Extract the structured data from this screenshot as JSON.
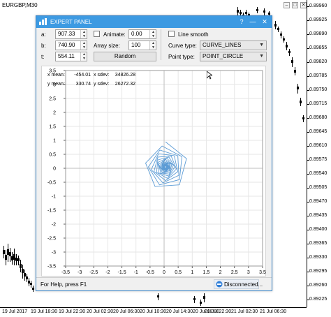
{
  "chart": {
    "symbol": "EURGBP,M30",
    "window_controls": {
      "minimize": "–",
      "restore": "□",
      "close": "✕"
    },
    "price_labels": [
      "0.89960",
      "0.89925",
      "0.89890",
      "0.89855",
      "0.89820",
      "0.89785",
      "0.89750",
      "0.89715",
      "0.89680",
      "0.89645",
      "0.89610",
      "0.89575",
      "0.89540",
      "0.89505",
      "0.89470",
      "0.89435",
      "0.89400",
      "0.89365",
      "0.89330",
      "0.89295",
      "0.89260",
      "0.89225"
    ],
    "time_labels": [
      "19 Jul 2017",
      "19 Jul 18:30",
      "19 Jul 22:30",
      "20 Jul 02:30",
      "20 Jul 06:30",
      "20 Jul 10:30",
      "20 Jul 14:30",
      "20 Jul 18:30",
      "20 Jul 22:30",
      "21 Jul 02:30",
      "21 Jul 06:30"
    ]
  },
  "panel": {
    "title": "EXPERT PANEL",
    "title_buttons": {
      "help": "?",
      "minimize": "—",
      "close": "✕"
    },
    "fields": {
      "a_label": "a:",
      "a_value": "907.33",
      "b_label": "b:",
      "b_value": "740.90",
      "t_label": "t:",
      "t_value": "554.11"
    },
    "animate_label": "Animate:",
    "animate_value": "0.00",
    "array_size_label": "Array size:",
    "array_size_value": "100",
    "random_button": "Random",
    "line_smooth_label": "Line smooth",
    "curve_type_label": "Curve type:",
    "curve_type_value": "CURVE_LINES",
    "point_type_label": "Point type:",
    "point_type_value": "POINT_CIRCLE"
  },
  "stats": {
    "x_mean_label": "x mean:",
    "x_mean_value": "-454.01",
    "x_sdev_label": "x sdev:",
    "x_sdev_value": "34826.28",
    "y_mean_label": "y mean:",
    "y_mean_value": "330.74",
    "y_sdev_label": "y sdev:",
    "y_sdev_value": "26272.32"
  },
  "chart_data": {
    "type": "line",
    "title": "",
    "xlabel": "",
    "ylabel": "",
    "xlim": [
      -3.5,
      3.5
    ],
    "ylim": [
      -3.5,
      3.5
    ],
    "x_ticks": [
      "-3.5",
      "-3",
      "-2.5",
      "-2",
      "-1.5",
      "-1",
      "-0.5",
      "0",
      "0.5",
      "1",
      "1.5",
      "2",
      "2.5",
      "3",
      "3.5"
    ],
    "y_ticks": [
      "3.5",
      "3",
      "2.5",
      "2",
      "1.5",
      "1",
      "0.5",
      "0",
      "-0.5",
      "-1",
      "-1.5",
      "-2",
      "-2.5",
      "-3",
      "-3.5"
    ],
    "grid": true,
    "series_color": "#5b9bd5",
    "series": [
      {
        "name": "",
        "turn_deg": 70,
        "growth": 1.034,
        "start_radius": 0.03,
        "points": 100,
        "x_scale": 2.2,
        "y_scale": 2.4,
        "x_shift": 0.05,
        "y_shift": 0.05
      }
    ]
  },
  "status": {
    "left": "For Help, press F1",
    "right": "Disconnected..."
  },
  "colors": {
    "accent": "#3d9ae2",
    "curve": "#5b9bd5"
  }
}
